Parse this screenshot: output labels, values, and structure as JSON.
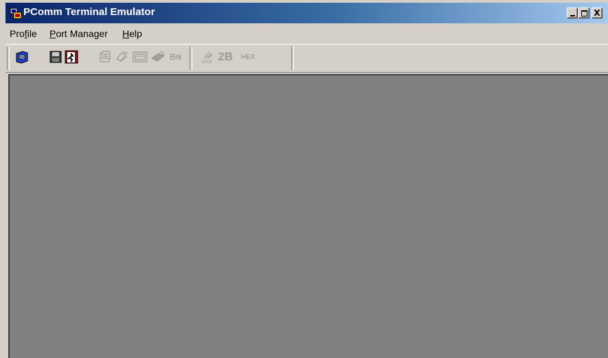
{
  "window": {
    "title": "PComm Terminal Emulator",
    "title_gradient_start": "#0a246a",
    "title_gradient_end": "#a6caf0",
    "controls": {
      "minimize_icon": "minimize-icon",
      "maximize_icon": "maximize-icon",
      "close_label": "X"
    }
  },
  "menubar": {
    "items": [
      {
        "label_pre": "Pro",
        "label_u": "f",
        "label_post": "ile"
      },
      {
        "label_pre": "",
        "label_u": "P",
        "label_post": "ort Manager"
      },
      {
        "label_pre": "",
        "label_u": "H",
        "label_post": "elp"
      }
    ]
  },
  "toolbar": {
    "buttons": [
      {
        "icon": "open-profile-icon",
        "enabled": true
      },
      {
        "icon": "save-icon",
        "enabled": false
      },
      {
        "icon": "exit-icon",
        "enabled": true
      },
      {
        "icon": "properties-icon",
        "enabled": false
      },
      {
        "icon": "transfer-icon",
        "enabled": false
      },
      {
        "icon": "terminal-icon",
        "enabled": false
      },
      {
        "icon": "send-icon",
        "enabled": false
      },
      {
        "icon": "break-icon",
        "label": "Brk",
        "enabled": false
      },
      {
        "icon": "binary-icon",
        "enabled": false
      },
      {
        "icon": "two-byte-icon",
        "label": "2B",
        "enabled": false
      },
      {
        "icon": "hex-icon",
        "label": "HEX",
        "enabled": false
      }
    ]
  },
  "client": {
    "background": "#808080"
  }
}
